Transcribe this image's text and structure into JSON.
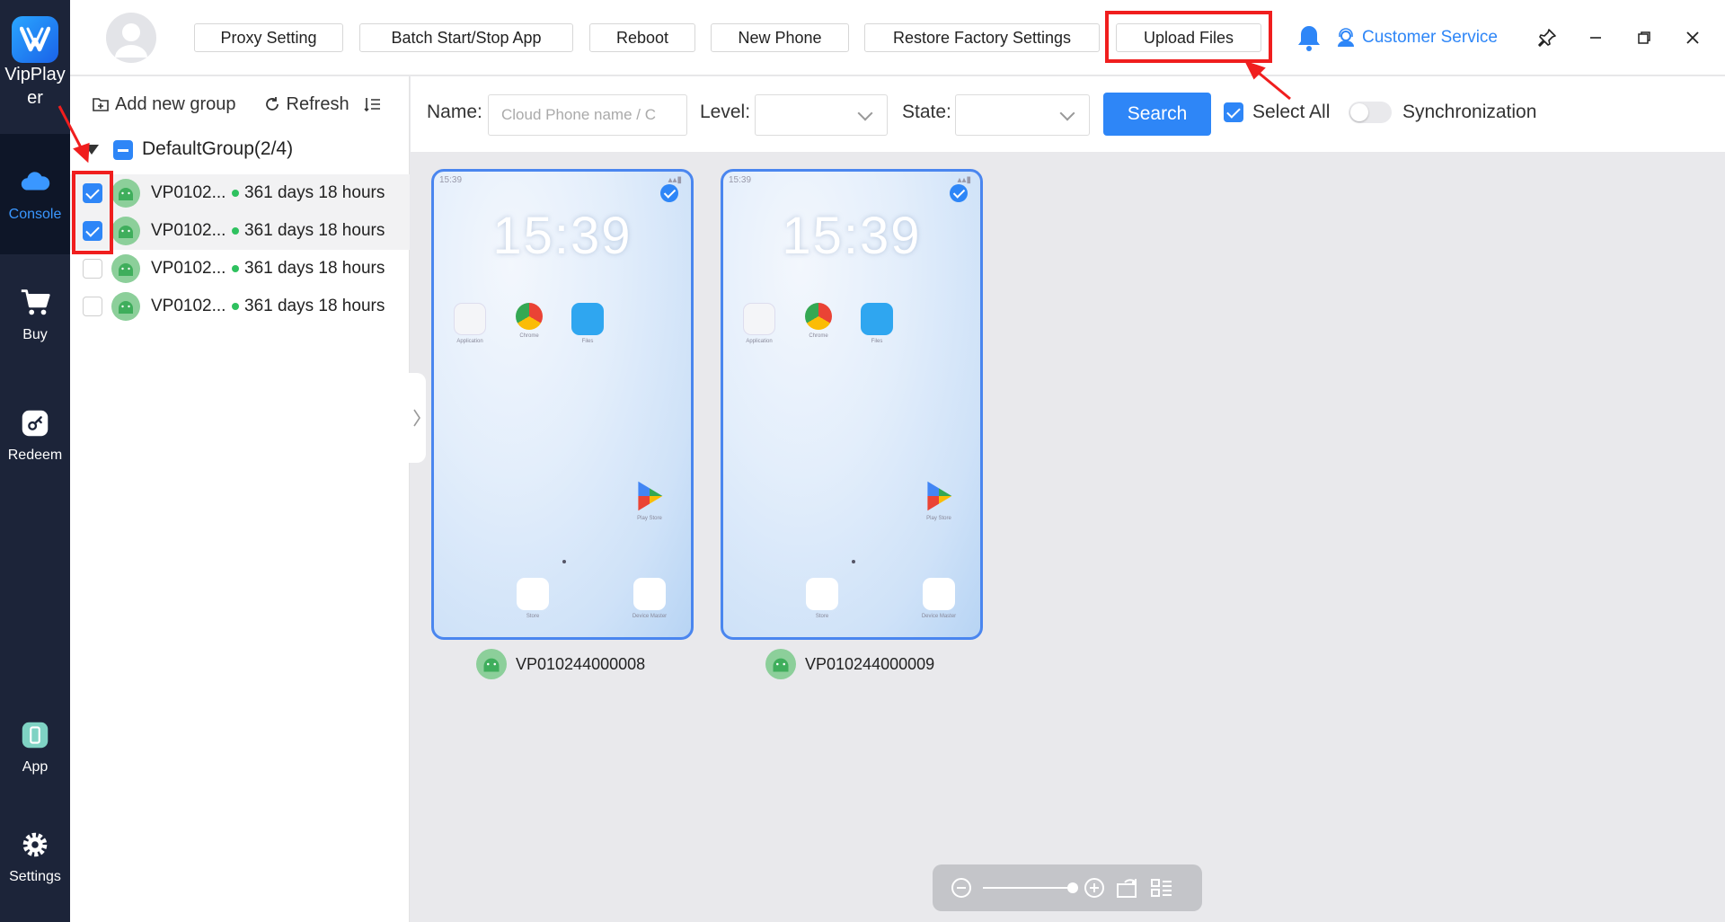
{
  "brand": {
    "name": "VipPlayer"
  },
  "nav": [
    {
      "id": "console",
      "label": "Console",
      "icon": "cloud-icon",
      "active": true
    },
    {
      "id": "buy",
      "label": "Buy",
      "icon": "cart-icon"
    },
    {
      "id": "redeem",
      "label": "Redeem",
      "icon": "key-icon"
    },
    {
      "id": "app",
      "label": "App",
      "icon": "phone-icon"
    },
    {
      "id": "settings",
      "label": "Settings",
      "icon": "gear-icon"
    }
  ],
  "toolbar": {
    "proxy": "Proxy Setting",
    "batch": "Batch Start/Stop App",
    "reboot": "Reboot",
    "new_phone": "New Phone",
    "restore": "Restore Factory Settings",
    "upload": "Upload Files",
    "customer_service": "Customer Service"
  },
  "panel": {
    "add_group": "Add new group",
    "refresh": "Refresh",
    "group_name": "DefaultGroup(2/4)",
    "devices": [
      {
        "name": "VP0102...",
        "time": "361 days 18 hours",
        "checked": true
      },
      {
        "name": "VP0102...",
        "time": "361 days 18 hours",
        "checked": true
      },
      {
        "name": "VP0102...",
        "time": "361 days 18 hours",
        "checked": false
      },
      {
        "name": "VP0102...",
        "time": "361 days 18 hours",
        "checked": false
      }
    ]
  },
  "filter": {
    "name_label": "Name:",
    "name_placeholder": "Cloud Phone name / C",
    "level_label": "Level:",
    "state_label": "State:",
    "search": "Search",
    "select_all": "Select All",
    "sync": "Synchronization"
  },
  "phones": [
    {
      "id": "VP010244000008",
      "status_time": "15:39",
      "clock": "15:39"
    },
    {
      "id": "VP010244000009",
      "status_time": "15:39",
      "clock": "15:39"
    }
  ],
  "phone_apps": {
    "application": "Application",
    "chrome": "Chrome",
    "files": "Files",
    "play_store": "Play Store",
    "store": "Store",
    "device_master": "Device Master"
  },
  "colors": {
    "accent": "#2e86f7",
    "nav_bg": "#1c2439",
    "highlight": "#f01e1e",
    "online": "#2fc15f"
  }
}
